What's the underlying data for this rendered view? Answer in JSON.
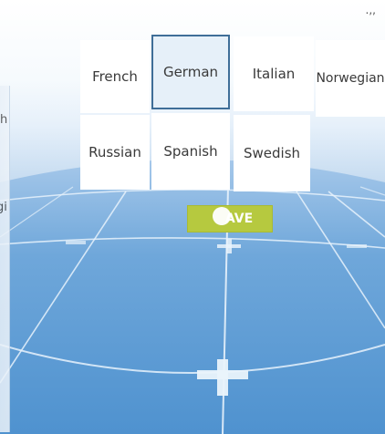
{
  "languages": {
    "row1": [
      "French",
      "German",
      "Italian",
      "Norwegian"
    ],
    "row2": [
      "Russian",
      "Spanish",
      "Swedish"
    ],
    "selected": "German"
  },
  "save_button": {
    "label": "AVE"
  },
  "side_panel": {
    "line1": "h",
    "line2": "gi"
  },
  "top_right": ".,,",
  "colors": {
    "floor": "#5a9ad3",
    "grid_line": "#e8f2fb",
    "save_bg": "#b6c93f",
    "selected_border": "#3f6e98"
  }
}
